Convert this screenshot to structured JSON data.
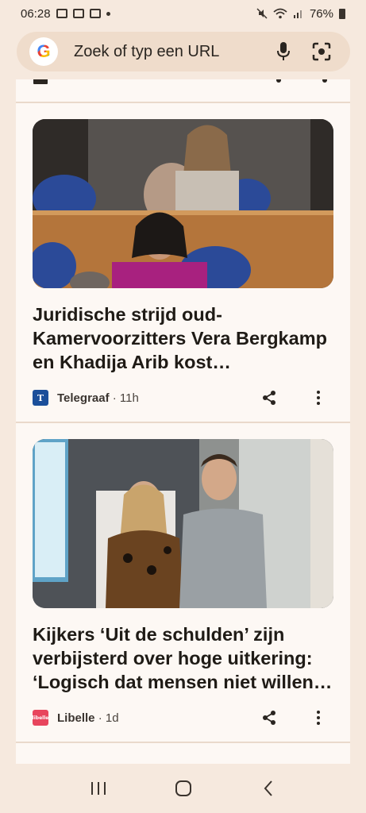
{
  "status_bar": {
    "time": "06:28",
    "battery": "76%",
    "notif_icons": [
      "gallery-icon",
      "mail-icon",
      "mail-icon",
      "dot-icon"
    ],
    "sys_icons": [
      "mute-icon",
      "wifi-icon",
      "signal-icon",
      "battery-icon"
    ]
  },
  "search": {
    "placeholder": "Zoek of typ een URL",
    "logo_letter": "G",
    "mic_icon": "mic-icon",
    "lens_icon": "camera-lens-icon"
  },
  "articles": [
    {
      "headline": "Juridische strijd oud-Kamervoorzitters Vera Bergkamp en Khadija Arib kost…",
      "source": "Telegraaf",
      "time": "· 11h",
      "logo_letter": "T",
      "logo_color": "#1b4f9a"
    },
    {
      "headline": "Kijkers ‘Uit de schulden’ zijn verbijsterd over hoge uitkering: ‘Logisch dat mensen niet willen…",
      "source": "Libelle",
      "time": "· 1d",
      "logo_letter": "libelle",
      "logo_color": "#e8455d"
    }
  ],
  "colors": {
    "background": "#f6e9de",
    "card": "#fdf8f4",
    "search_bar": "#efdccb"
  }
}
